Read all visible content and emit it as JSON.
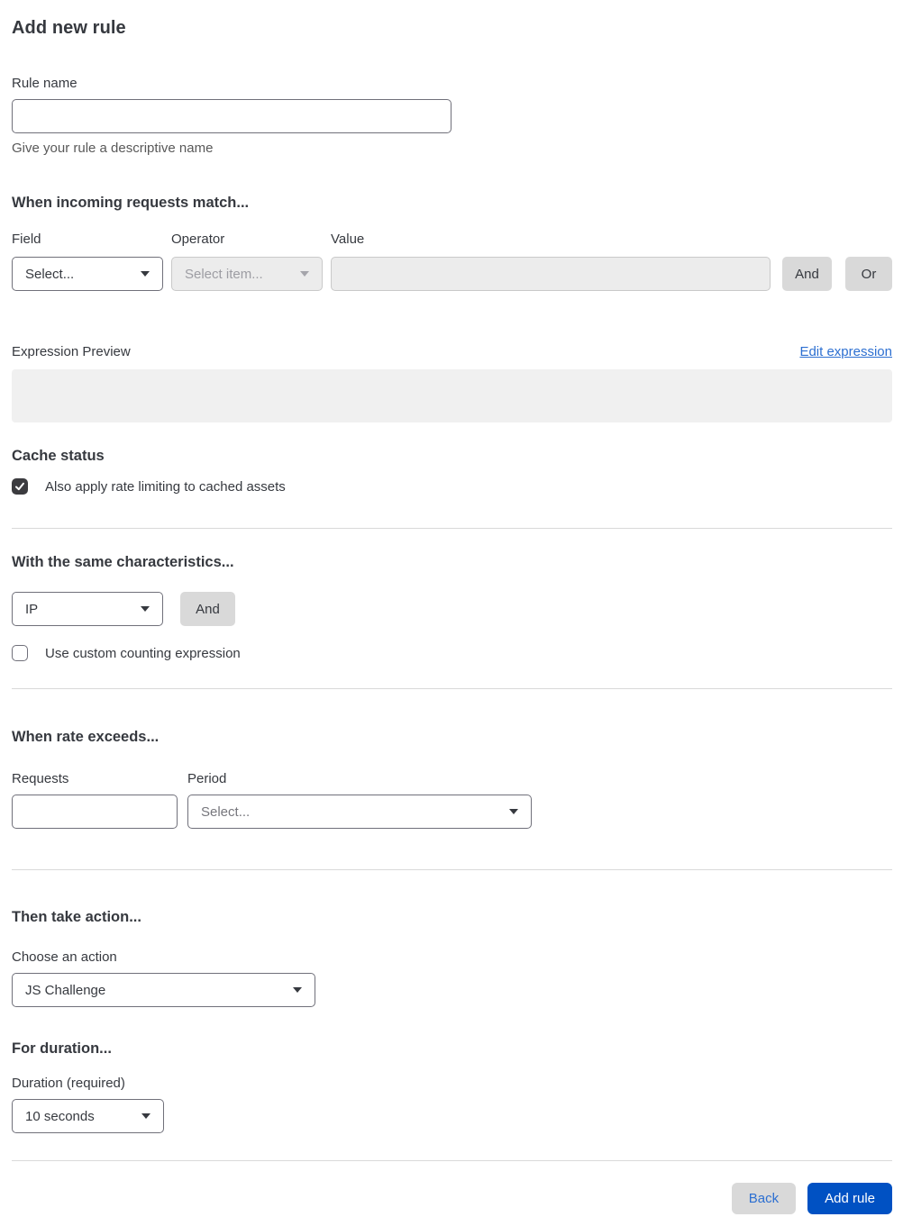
{
  "page": {
    "title": "Add new rule"
  },
  "rule_name": {
    "label": "Rule name",
    "value": "",
    "helper": "Give your rule a descriptive name"
  },
  "match_section": {
    "heading": "When incoming requests match...",
    "field": {
      "label": "Field",
      "selected": "Select..."
    },
    "operator": {
      "label": "Operator",
      "selected": "Select item...",
      "disabled": true
    },
    "value": {
      "label": "Value",
      "value": "",
      "disabled": true
    },
    "and_label": "And",
    "or_label": "Or",
    "expression_preview_label": "Expression Preview",
    "edit_expression_label": "Edit expression",
    "expression_preview_value": ""
  },
  "cache_section": {
    "heading": "Cache status",
    "checkbox_label": "Also apply rate limiting to cached assets",
    "checked": true
  },
  "characteristics_section": {
    "heading": "With the same characteristics...",
    "characteristic_selected": "IP",
    "and_label": "And",
    "checkbox_label": "Use custom counting expression",
    "checked": false
  },
  "rate_section": {
    "heading": "When rate exceeds...",
    "requests_label": "Requests",
    "requests_value": "",
    "period_label": "Period",
    "period_selected": "Select..."
  },
  "action_section": {
    "heading": "Then take action...",
    "label": "Choose an action",
    "selected": "JS Challenge"
  },
  "duration_section": {
    "heading": "For duration...",
    "label": "Duration (required)",
    "selected": "10 seconds"
  },
  "footer": {
    "back_label": "Back",
    "add_rule_label": "Add rule"
  },
  "colors": {
    "accent_blue": "#0051c3",
    "link_blue": "#2c6fd1",
    "text_dark": "#36393f",
    "text_muted": "#595959",
    "control_border": "#70707a",
    "disabled_bg": "#ececec",
    "disabled_border": "#c9c9c9",
    "disabled_text": "#9d9da3",
    "gray_button_bg": "#d9d9d9",
    "divider": "#d9d9d9",
    "preview_bg": "#f0f0f0",
    "checkbox_checked_bg": "#3b3b3f"
  }
}
